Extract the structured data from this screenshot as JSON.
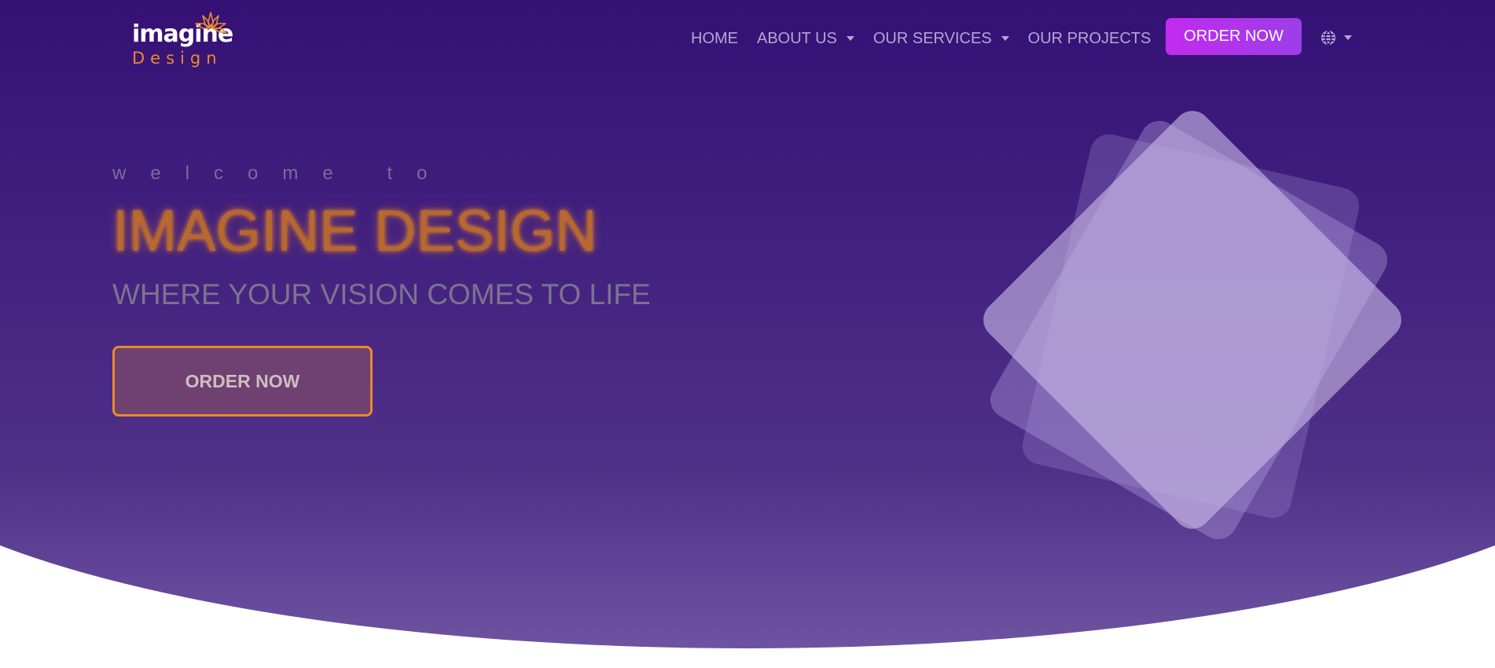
{
  "brand": {
    "logo_word": "imagine",
    "logo_sub": "Design"
  },
  "nav": {
    "items": [
      {
        "label": "HOME",
        "has_dropdown": false
      },
      {
        "label": "ABOUT US",
        "has_dropdown": true
      },
      {
        "label": "OUR SERVICES",
        "has_dropdown": true
      },
      {
        "label": "OUR PROJECTS",
        "has_dropdown": false
      }
    ],
    "order_label": "ORDER NOW",
    "language_icon": "globe-icon"
  },
  "hero": {
    "welcome": "welcome to",
    "title": "IMAGINE DESIGN",
    "tagline": "WHERE YOUR VISION COMES TO LIFE",
    "order_label": "ORDER NOW"
  },
  "colors": {
    "background_top": "#300b73",
    "background_bottom": "#6e53a1",
    "accent_orange": "#e98a2a",
    "button_gradient_start": "#c32af0",
    "button_gradient_end": "#9c3ee8",
    "nav_text": "#b3a7d4"
  }
}
